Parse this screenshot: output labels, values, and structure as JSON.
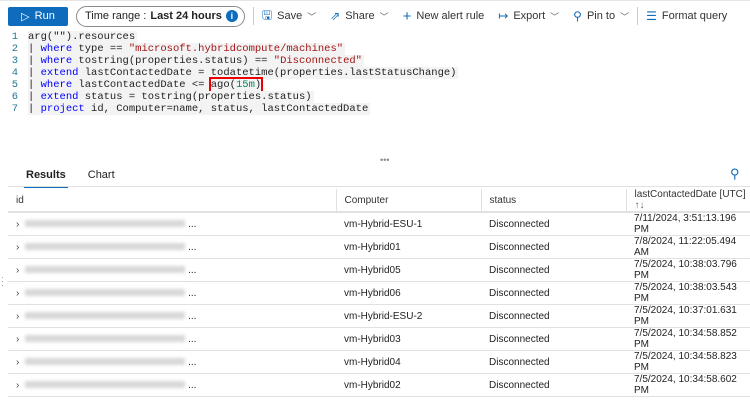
{
  "toolbar": {
    "run": "Run",
    "time_label": "Time range :",
    "time_value": "Last 24 hours",
    "save": "Save",
    "share": "Share",
    "new_alert": "New alert rule",
    "export": "Export",
    "pin": "Pin to",
    "format": "Format query"
  },
  "editor": {
    "lines": [
      "arg(\"\").resources",
      "| where type == \"microsoft.hybridcompute/machines\"",
      "| where tostring(properties.status) == \"Disconnected\"",
      "| extend lastContactedDate = todatetime(properties.lastStatusChange)",
      "| where lastContactedDate <= ago(15m)",
      "| extend status = tostring(properties.status)",
      "| project id, Computer=name, status, lastContactedDate"
    ]
  },
  "tabs": [
    "Results",
    "Chart"
  ],
  "table": {
    "headers": [
      "id",
      "Computer",
      "status",
      "lastContactedDate [UTC]"
    ],
    "ellipsis": "...",
    "rows": [
      [
        "vm-Hybrid-ESU-1",
        "Disconnected",
        "7/11/2024, 3:51:13.196 PM"
      ],
      [
        "vm-Hybrid01",
        "Disconnected",
        "7/8/2024, 11:22:05.494 AM"
      ],
      [
        "vm-Hybrid05",
        "Disconnected",
        "7/5/2024, 10:38:03.796 PM"
      ],
      [
        "vm-Hybrid06",
        "Disconnected",
        "7/5/2024, 10:38:03.543 PM"
      ],
      [
        "vm-Hybrid-ESU-2",
        "Disconnected",
        "7/5/2024, 10:37:01.631 PM"
      ],
      [
        "vm-Hybrid03",
        "Disconnected",
        "7/5/2024, 10:34:58.852 PM"
      ],
      [
        "vm-Hybrid04",
        "Disconnected",
        "7/5/2024, 10:34:58.823 PM"
      ],
      [
        "vm-Hybrid02",
        "Disconnected",
        "7/5/2024, 10:34:58.602 PM"
      ]
    ]
  }
}
